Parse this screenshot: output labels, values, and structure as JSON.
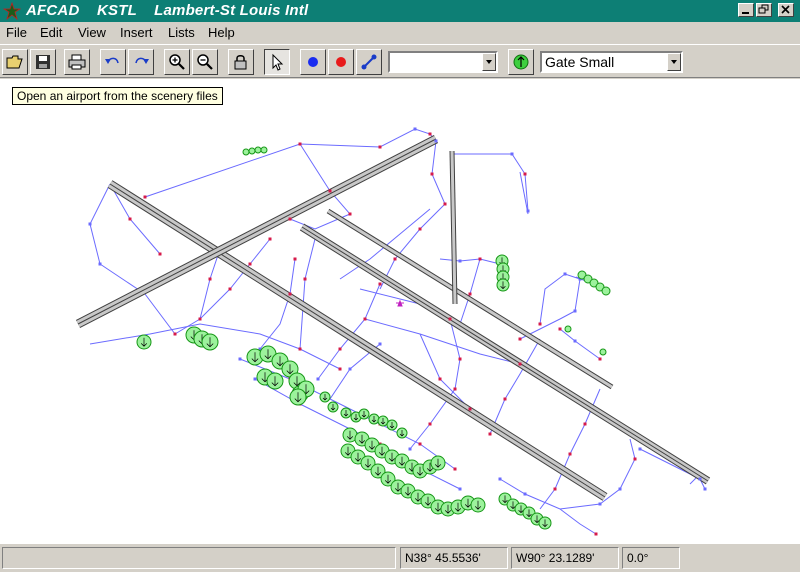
{
  "window": {
    "title": "AFCAD    KSTL    Lambert-St Louis Intl",
    "controls": [
      "minimize",
      "maximize",
      "close"
    ]
  },
  "menu": [
    "File",
    "Edit",
    "View",
    "Insert",
    "Lists",
    "Help"
  ],
  "toolbar": {
    "buttons": [
      {
        "name": "open-icon"
      },
      {
        "name": "save-icon"
      },
      {
        "name": "print-icon"
      },
      {
        "name": "undo-icon"
      },
      {
        "name": "redo-icon"
      },
      {
        "name": "zoom-in-icon"
      },
      {
        "name": "zoom-out-icon"
      },
      {
        "name": "lock-icon"
      },
      {
        "name": "pointer-icon"
      },
      {
        "name": "blue-node-icon"
      },
      {
        "name": "red-node-icon"
      },
      {
        "name": "link-icon"
      },
      {
        "name": "parking-icon"
      }
    ],
    "combo1_value": "",
    "combo2_value": "Gate Small"
  },
  "tooltip": "Open an airport from the scenery files",
  "status": {
    "message": "",
    "latitude": "N38° 45.5536'",
    "longitude": "W90° 23.1289'",
    "heading": "0.0°"
  },
  "colors": {
    "titlebar": "#0d7f75",
    "taxi_link": "#6b6bff",
    "node": "#d61a4a",
    "runway_fill": "#c8c8c8",
    "parking_fill": "#9cf29c",
    "parking_stroke": "#169616"
  }
}
